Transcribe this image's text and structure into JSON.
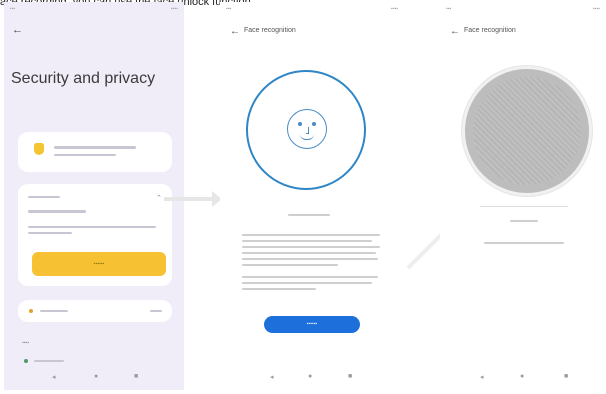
{
  "caption": "ace recording, you can use the face unlock function.",
  "colors": {
    "accent_blue": "#1d6fdc",
    "ring_blue": "#2f86c6",
    "accent_yellow": "#f6c233",
    "phone1_bg": "#f1edf8"
  },
  "phone1": {
    "title": "Security and privacy",
    "back_icon": "back-arrow-icon"
  },
  "phone2": {
    "back_icon": "back-arrow-icon",
    "header_title": "Face recognition"
  },
  "phone3": {
    "back_icon": "back-arrow-icon",
    "header_title": "Face recognition"
  }
}
